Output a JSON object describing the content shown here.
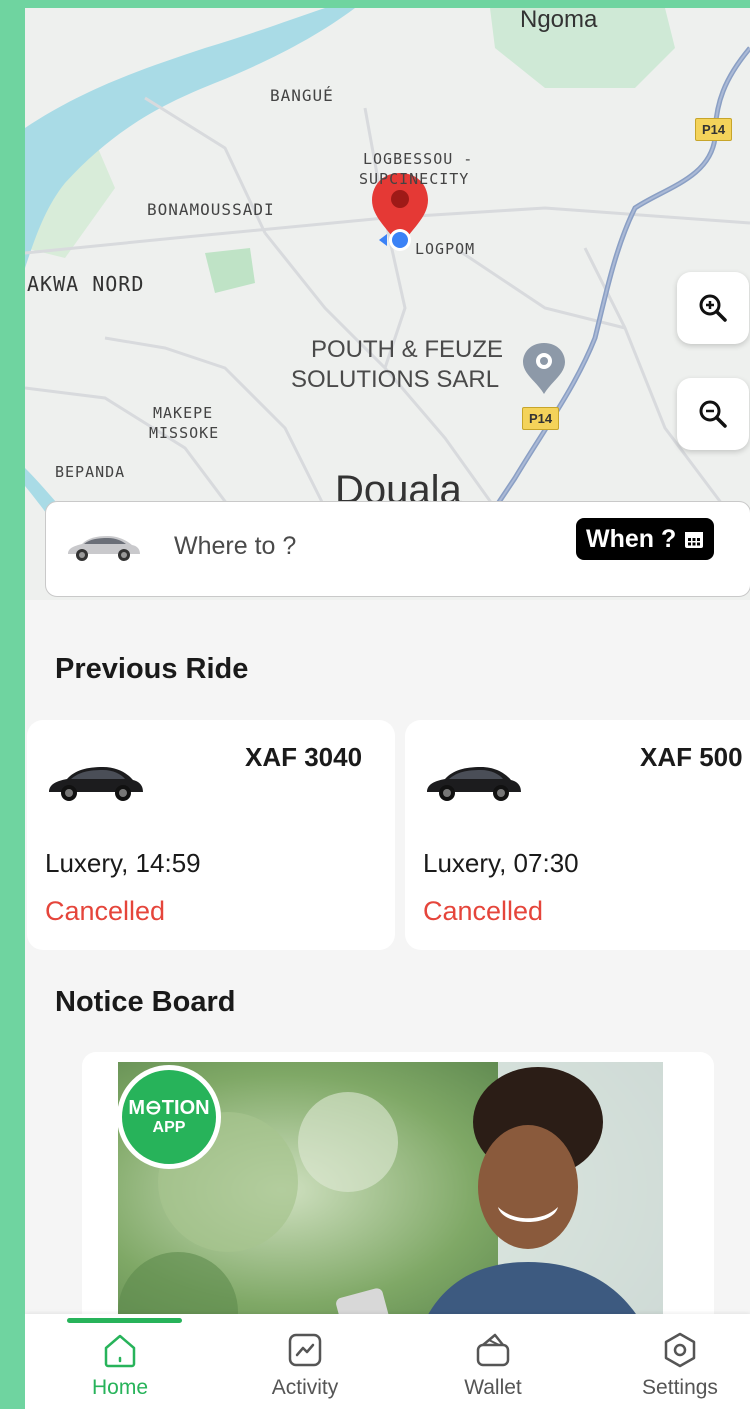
{
  "map": {
    "places": {
      "ngoma": "Ngoma",
      "bangue": "BANGUÉ",
      "logbessou_line1": "LOGBESSOU -",
      "logbessou_line2": "SUPCINECITY",
      "bonamoussadi": "BONAMOUSSADI",
      "logpom": "LOGPOM",
      "akwa_nord": "AKWA NORD",
      "pouth_line1": "POUTH & FEUZE",
      "pouth_line2": "SOLUTIONS SARL",
      "makepe_line1": "MAKEPE",
      "makepe_line2": "MISSOKE",
      "bepanda": "BEPANDA",
      "douala": "Douala"
    },
    "road_shields": [
      "P14",
      "P14"
    ],
    "zoom_in_icon": "zoom-in-icon",
    "zoom_out_icon": "zoom-out-icon"
  },
  "search": {
    "placeholder": "Where to ?",
    "when_label": "When ?",
    "when_icon": "calendar-icon"
  },
  "previous_ride": {
    "title": "Previous Ride",
    "rides": [
      {
        "price": "XAF 3040",
        "info": "Luxery, 14:59",
        "status": "Cancelled"
      },
      {
        "price": "XAF 500",
        "info": "Luxery, 07:30",
        "status": "Cancelled"
      }
    ]
  },
  "notice_board": {
    "title": "Notice Board",
    "badge_line1": "M⊖TION",
    "badge_line2": "APP"
  },
  "nav": {
    "items": [
      {
        "label": "Home",
        "icon": "home-icon",
        "active": true
      },
      {
        "label": "Activity",
        "icon": "activity-icon",
        "active": false
      },
      {
        "label": "Wallet",
        "icon": "wallet-icon",
        "active": false
      },
      {
        "label": "Settings",
        "icon": "settings-icon",
        "active": false
      }
    ]
  },
  "colors": {
    "accent": "#27b35a",
    "frame": "#6fd4a0",
    "cancelled": "#e5453b"
  }
}
